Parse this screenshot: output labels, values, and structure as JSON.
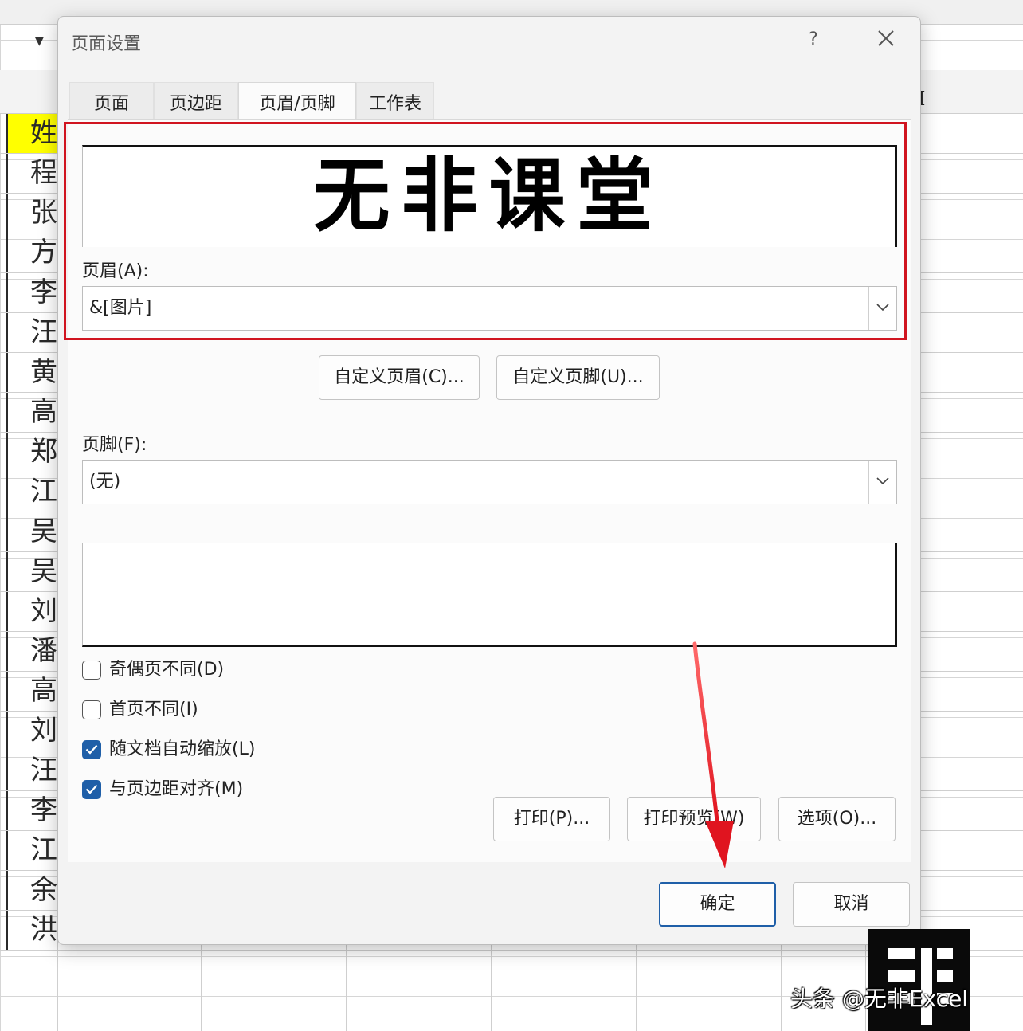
{
  "colors": {
    "accent": "#1f5fa8",
    "highlight_box": "#d0141f",
    "arrow": "#e0141f",
    "header_cell": "#ffff00"
  },
  "sheet": {
    "column_header_visible": "I",
    "name_column": [
      "姓",
      "程",
      "张",
      "方",
      "李",
      "汪",
      "黄",
      "高",
      "郑",
      "江",
      "吴",
      "吴",
      "刘",
      "潘",
      "高",
      "刘",
      "汪",
      "李",
      "江",
      "余",
      "洪"
    ]
  },
  "dialog": {
    "title": "页面设置",
    "help": "?",
    "close": "✕",
    "tabs": [
      "页面",
      "页边距",
      "页眉/页脚",
      "工作表"
    ],
    "active_tab": "页眉/页脚",
    "header_preview_text": "无非课堂",
    "header_label": "页眉(A):",
    "header_value": "&[图片]",
    "custom_header_button": "自定义页眉(C)...",
    "custom_footer_button": "自定义页脚(U)...",
    "footer_label": "页脚(F):",
    "footer_value": "(无)",
    "options": [
      {
        "label": "奇偶页不同(D)",
        "checked": false
      },
      {
        "label": "首页不同(I)",
        "checked": false
      },
      {
        "label": "随文档自动缩放(L)",
        "checked": true
      },
      {
        "label": "与页边距对齐(M)",
        "checked": true
      }
    ],
    "print_button": "打印(P)...",
    "print_preview_button": "打印预览(W)",
    "options_button": "选项(O)...",
    "ok_button": "确定",
    "cancel_button": "取消"
  },
  "watermark": {
    "text": "头条 @无非Excel"
  }
}
